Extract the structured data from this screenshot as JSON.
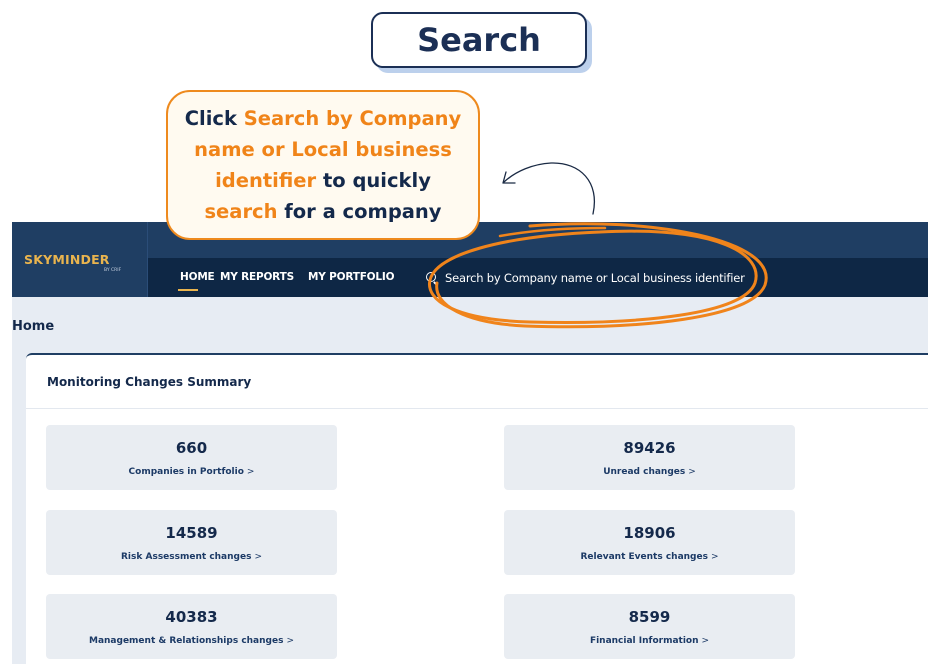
{
  "header": {
    "title": "Search"
  },
  "callout": {
    "parts": [
      {
        "text": "Click ",
        "highlight": false
      },
      {
        "text": "Search by Company name or Local business identifier",
        "highlight": true
      },
      {
        "text": " to quickly ",
        "highlight": false
      },
      {
        "text": "search",
        "highlight": true
      },
      {
        "text": " for a company",
        "highlight": false
      }
    ]
  },
  "app": {
    "logo": {
      "name": "SKYMINDER",
      "sub": "BY CRIF"
    },
    "nav": {
      "home": "HOME",
      "reports": "MY REPORTS",
      "portfolio": "MY PORTFOLIO"
    },
    "search": {
      "placeholder": "Search by Company name or Local business identifier",
      "icon": "search-icon"
    },
    "page_title": "Home",
    "panel_title": "Monitoring Changes Summary",
    "cards": [
      {
        "value": "660",
        "label": "Companies in Portfolio",
        "chevron": ">"
      },
      {
        "value": "89426",
        "label": "Unread changes",
        "chevron": ">"
      },
      {
        "value": "14589",
        "label": "Risk Assessment changes",
        "chevron": ">"
      },
      {
        "value": "18906",
        "label": "Relevant Events changes",
        "chevron": ">"
      },
      {
        "value": "40383",
        "label": "Management & Relationships changes",
        "chevron": ">"
      },
      {
        "value": "8599",
        "label": "Financial Information",
        "chevron": ">"
      }
    ]
  },
  "colors": {
    "accent": "#f08419",
    "navy": "#14294b",
    "topbar": "#1f3e63",
    "navrow": "#0e2745",
    "logo": "#e9b44e"
  }
}
